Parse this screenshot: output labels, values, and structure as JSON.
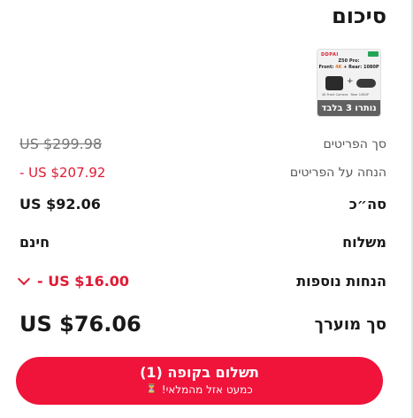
{
  "summary": {
    "title": "סיכום"
  },
  "product": {
    "brand": "DDPAI",
    "line1": "Z50 Pro:",
    "line2_prefix": "Front: ",
    "line2_hi": "4K",
    "line2_suffix": " + Rear: 1080P",
    "caption": "4K Front Camera · Rear 1080P",
    "badge": "נותרו 3 בלבד"
  },
  "rows": {
    "items_subtotal": {
      "label": "סך הפריטים",
      "value": "US $299.98"
    },
    "items_discount": {
      "label": "הנחה על הפריטים",
      "value": "- US $207.92"
    },
    "subtotal": {
      "label": "סה״כ",
      "value": "US $92.06"
    },
    "shipping": {
      "label": "משלוח",
      "value": "חינם"
    },
    "extra_discounts": {
      "label": "הנחות נוספות",
      "value": "- US $16.00"
    },
    "total": {
      "label": "סך מוערך",
      "value": "US $76.06"
    }
  },
  "checkout": {
    "label": "תשלום בקופה (1)",
    "subtext": "כמעט אזל מהמלאי!"
  },
  "colors": {
    "accent": "#f0133a",
    "discount": "#e01b35"
  },
  "icons": {
    "expand": "chevron-down-icon",
    "stock": "hourglass-icon"
  }
}
